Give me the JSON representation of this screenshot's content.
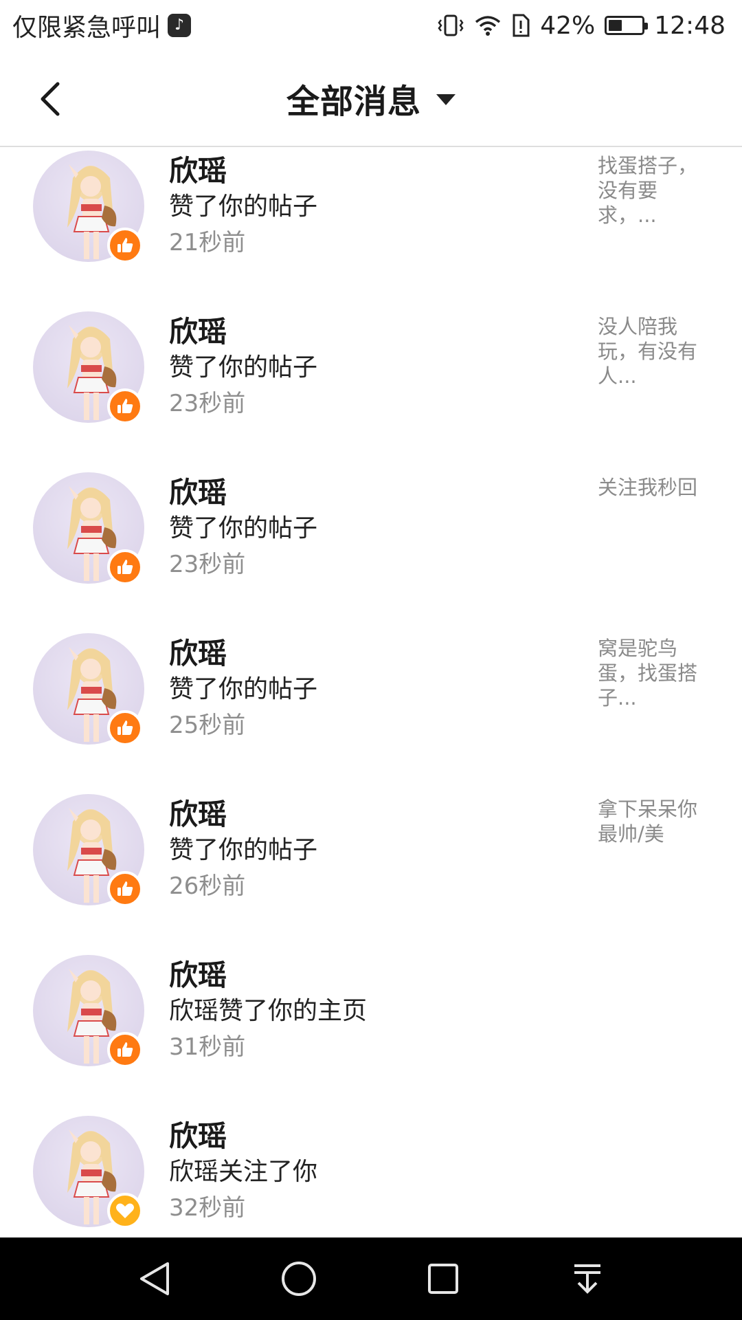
{
  "status_bar": {
    "carrier_text": "仅限紧急呼叫",
    "app_icon": "tiktok-icon",
    "battery_percent": "42%",
    "battery_level": 0.42,
    "time": "12:48",
    "icons": [
      "vibrate-icon",
      "wifi-icon",
      "sim-alert-icon",
      "battery-icon"
    ]
  },
  "header": {
    "back_icon": "chevron-left-icon",
    "title": "全部消息",
    "dropdown_icon": "caret-down-icon"
  },
  "messages": [
    {
      "name": "欣瑶",
      "action": "赞了你的帖子",
      "time": "21秒前",
      "snippet": "找蛋搭子，没有要求，...",
      "badge": "thumb-up-icon"
    },
    {
      "name": "欣瑶",
      "action": "赞了你的帖子",
      "time": "23秒前",
      "snippet": "没人陪我玩，有没有人...",
      "badge": "thumb-up-icon"
    },
    {
      "name": "欣瑶",
      "action": "赞了你的帖子",
      "time": "23秒前",
      "snippet": "关注我秒回",
      "badge": "thumb-up-icon"
    },
    {
      "name": "欣瑶",
      "action": "赞了你的帖子",
      "time": "25秒前",
      "snippet": "窝是驼鸟蛋，找蛋搭子...",
      "badge": "thumb-up-icon"
    },
    {
      "name": "欣瑶",
      "action": "赞了你的帖子",
      "time": "26秒前",
      "snippet": "拿下呆呆你最帅/美",
      "badge": "thumb-up-icon"
    },
    {
      "name": "欣瑶",
      "action": "欣瑶赞了你的主页",
      "time": "31秒前",
      "snippet": "",
      "badge": "thumb-up-icon"
    },
    {
      "name": "欣瑶",
      "action": "欣瑶关注了你",
      "time": "32秒前",
      "snippet": "",
      "badge": "heart-icon"
    }
  ],
  "nav_bar": {
    "buttons": [
      "back-triangle-icon",
      "home-circle-icon",
      "recents-square-icon",
      "notification-pull-icon"
    ]
  },
  "colors": {
    "like_badge": "#ff7a12",
    "follow_badge": "#ffb21a",
    "muted_text": "#8e8e8e"
  }
}
